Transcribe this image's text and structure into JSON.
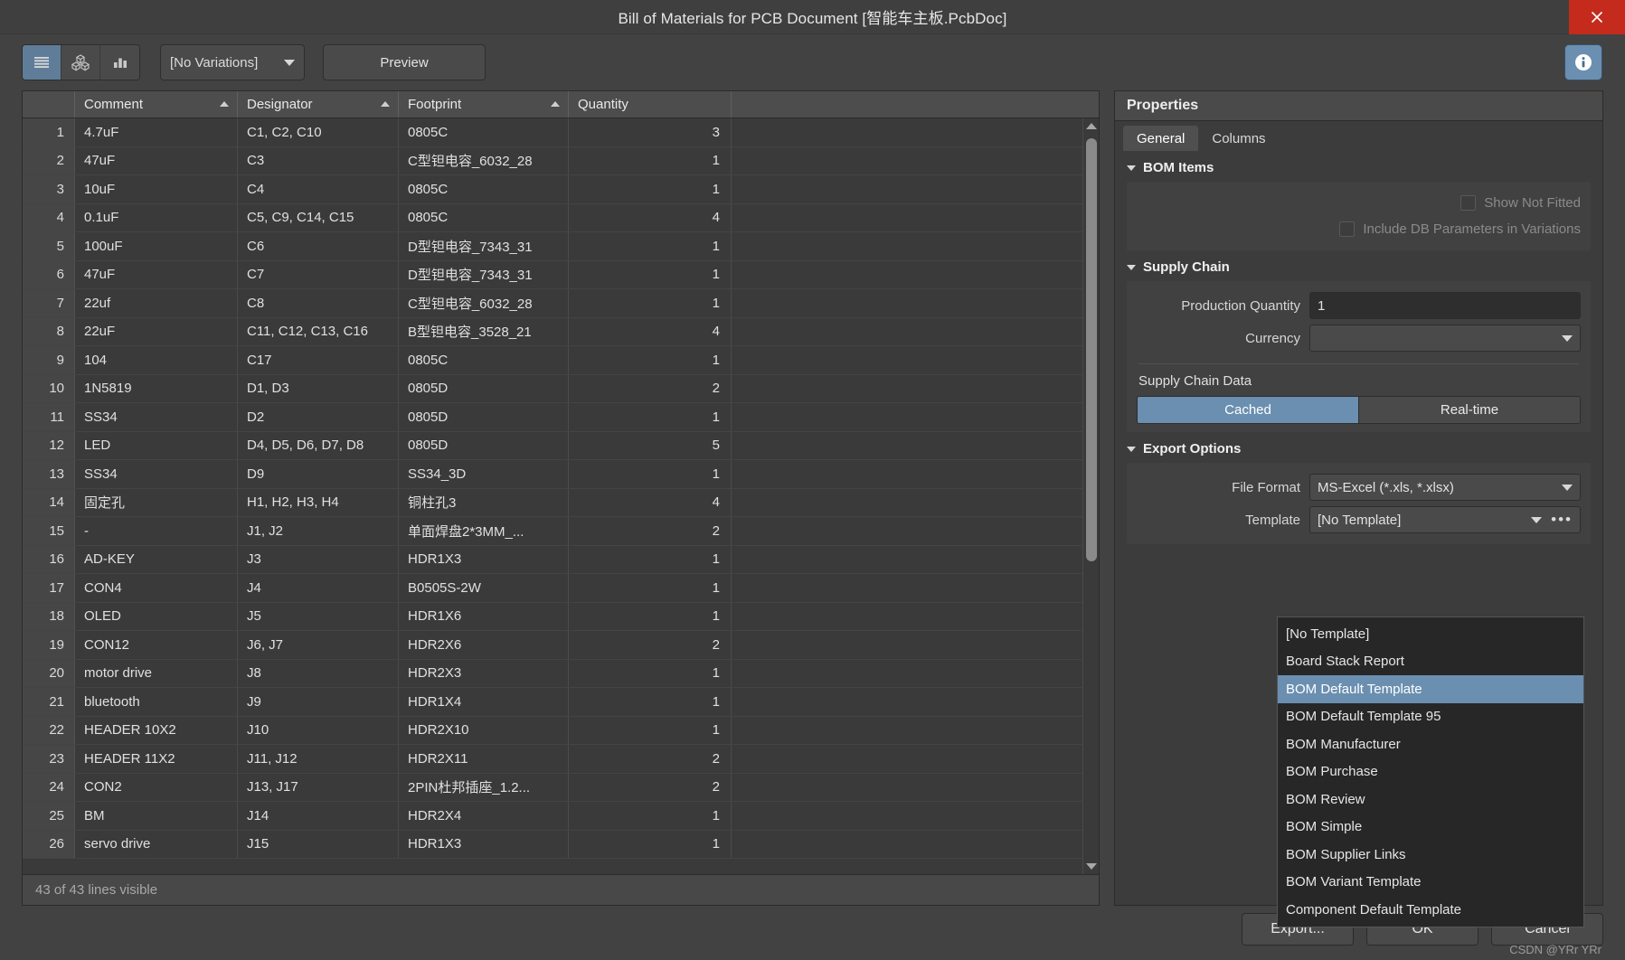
{
  "window": {
    "title": "Bill of Materials for PCB Document [智能车主板.PcbDoc]",
    "close_icon": "close-icon"
  },
  "toolbar": {
    "view_buttons": [
      {
        "name": "list-view",
        "icon": "list-lines-icon",
        "active": true
      },
      {
        "name": "blocks-view",
        "icon": "cubes-icon",
        "active": false
      },
      {
        "name": "chart-view",
        "icon": "bar-chart-icon",
        "active": false
      }
    ],
    "variations": "[No Variations]",
    "preview_label": "Preview",
    "info_icon": "info-icon"
  },
  "table": {
    "columns": [
      "",
      "Comment",
      "Designator",
      "Footprint",
      "Quantity",
      ""
    ],
    "sort_indicators": [
      "Comment",
      "Designator",
      "Footprint"
    ],
    "rows": [
      {
        "n": "1",
        "comment": "4.7uF",
        "designator": "C1, C2, C10",
        "footprint": "0805C",
        "qty": "3"
      },
      {
        "n": "2",
        "comment": "47uF",
        "designator": "C3",
        "footprint": "C型钽电容_6032_28",
        "qty": "1"
      },
      {
        "n": "3",
        "comment": "10uF",
        "designator": "C4",
        "footprint": "0805C",
        "qty": "1"
      },
      {
        "n": "4",
        "comment": "0.1uF",
        "designator": "C5, C9, C14, C15",
        "footprint": "0805C",
        "qty": "4"
      },
      {
        "n": "5",
        "comment": "100uF",
        "designator": "C6",
        "footprint": "D型钽电容_7343_31",
        "qty": "1"
      },
      {
        "n": "6",
        "comment": "47uF",
        "designator": "C7",
        "footprint": "D型钽电容_7343_31",
        "qty": "1"
      },
      {
        "n": "7",
        "comment": "22uf",
        "designator": "C8",
        "footprint": "C型钽电容_6032_28",
        "qty": "1"
      },
      {
        "n": "8",
        "comment": "22uF",
        "designator": "C11, C12, C13, C16",
        "footprint": "B型钽电容_3528_21",
        "qty": "4"
      },
      {
        "n": "9",
        "comment": "104",
        "designator": "C17",
        "footprint": "0805C",
        "qty": "1"
      },
      {
        "n": "10",
        "comment": "1N5819",
        "designator": "D1, D3",
        "footprint": "0805D",
        "qty": "2"
      },
      {
        "n": "11",
        "comment": "SS34",
        "designator": "D2",
        "footprint": "0805D",
        "qty": "1"
      },
      {
        "n": "12",
        "comment": "LED",
        "designator": "D4, D5, D6, D7, D8",
        "footprint": "0805D",
        "qty": "5"
      },
      {
        "n": "13",
        "comment": "SS34",
        "designator": "D9",
        "footprint": "SS34_3D",
        "qty": "1"
      },
      {
        "n": "14",
        "comment": "固定孔",
        "designator": "H1, H2, H3, H4",
        "footprint": "铜柱孔3",
        "qty": "4"
      },
      {
        "n": "15",
        "comment": "-",
        "designator": "J1, J2",
        "footprint": "单面焊盘2*3MM_...",
        "qty": "2"
      },
      {
        "n": "16",
        "comment": "AD-KEY",
        "designator": "J3",
        "footprint": "HDR1X3",
        "qty": "1"
      },
      {
        "n": "17",
        "comment": "CON4",
        "designator": "J4",
        "footprint": "B0505S-2W",
        "qty": "1"
      },
      {
        "n": "18",
        "comment": "OLED",
        "designator": "J5",
        "footprint": "HDR1X6",
        "qty": "1"
      },
      {
        "n": "19",
        "comment": "CON12",
        "designator": "J6, J7",
        "footprint": "HDR2X6",
        "qty": "2"
      },
      {
        "n": "20",
        "comment": "motor drive",
        "designator": "J8",
        "footprint": "HDR2X3",
        "qty": "1"
      },
      {
        "n": "21",
        "comment": "bluetooth",
        "designator": "J9",
        "footprint": "HDR1X4",
        "qty": "1"
      },
      {
        "n": "22",
        "comment": "HEADER 10X2",
        "designator": "J10",
        "footprint": "HDR2X10",
        "qty": "1"
      },
      {
        "n": "23",
        "comment": "HEADER 11X2",
        "designator": "J11, J12",
        "footprint": "HDR2X11",
        "qty": "2"
      },
      {
        "n": "24",
        "comment": "CON2",
        "designator": "J13, J17",
        "footprint": "2PIN杜邦插座_1.2...",
        "qty": "2"
      },
      {
        "n": "25",
        "comment": "BM",
        "designator": "J14",
        "footprint": "HDR2X4",
        "qty": "1"
      },
      {
        "n": "26",
        "comment": "servo drive",
        "designator": "J15",
        "footprint": "HDR1X3",
        "qty": "1"
      }
    ],
    "status": "43 of 43 lines visible"
  },
  "properties": {
    "header": "Properties",
    "tabs": [
      {
        "label": "General",
        "active": true
      },
      {
        "label": "Columns",
        "active": false
      }
    ],
    "bom_items": {
      "title": "BOM Items",
      "show_not_fitted": "Show Not Fitted",
      "include_db_params": "Include DB Parameters in Variations"
    },
    "supply_chain": {
      "title": "Supply Chain",
      "production_quantity_label": "Production Quantity",
      "production_quantity_value": "1",
      "currency_label": "Currency",
      "currency_value": "",
      "data_label": "Supply Chain Data",
      "cached_label": "Cached",
      "realtime_label": "Real-time",
      "selected": "Cached"
    },
    "export_options": {
      "title": "Export Options",
      "file_format_label": "File Format",
      "file_format_value": "MS-Excel (*.xls, *.xlsx)",
      "template_label": "Template",
      "template_value": "[No Template]",
      "more_icon": "ellipsis-icon",
      "dropdown": {
        "open": true,
        "selected": "BOM Default Template",
        "items": [
          "[No Template]",
          "Board Stack Report",
          "BOM Default Template",
          "BOM Default Template 95",
          "BOM Manufacturer",
          "BOM Purchase",
          "BOM Review",
          "BOM Simple",
          "BOM Supplier Links",
          "BOM Variant Template",
          "Component Default Template"
        ]
      }
    }
  },
  "footer": {
    "export_label": "Export...",
    "ok_label": "OK",
    "cancel_label": "Cancel",
    "watermark": "CSDN @YRr YRr"
  },
  "colors": {
    "accent": "#6b8fb0",
    "close": "#c42b1c",
    "panel": "#3c3c3c",
    "window": "#424242"
  }
}
